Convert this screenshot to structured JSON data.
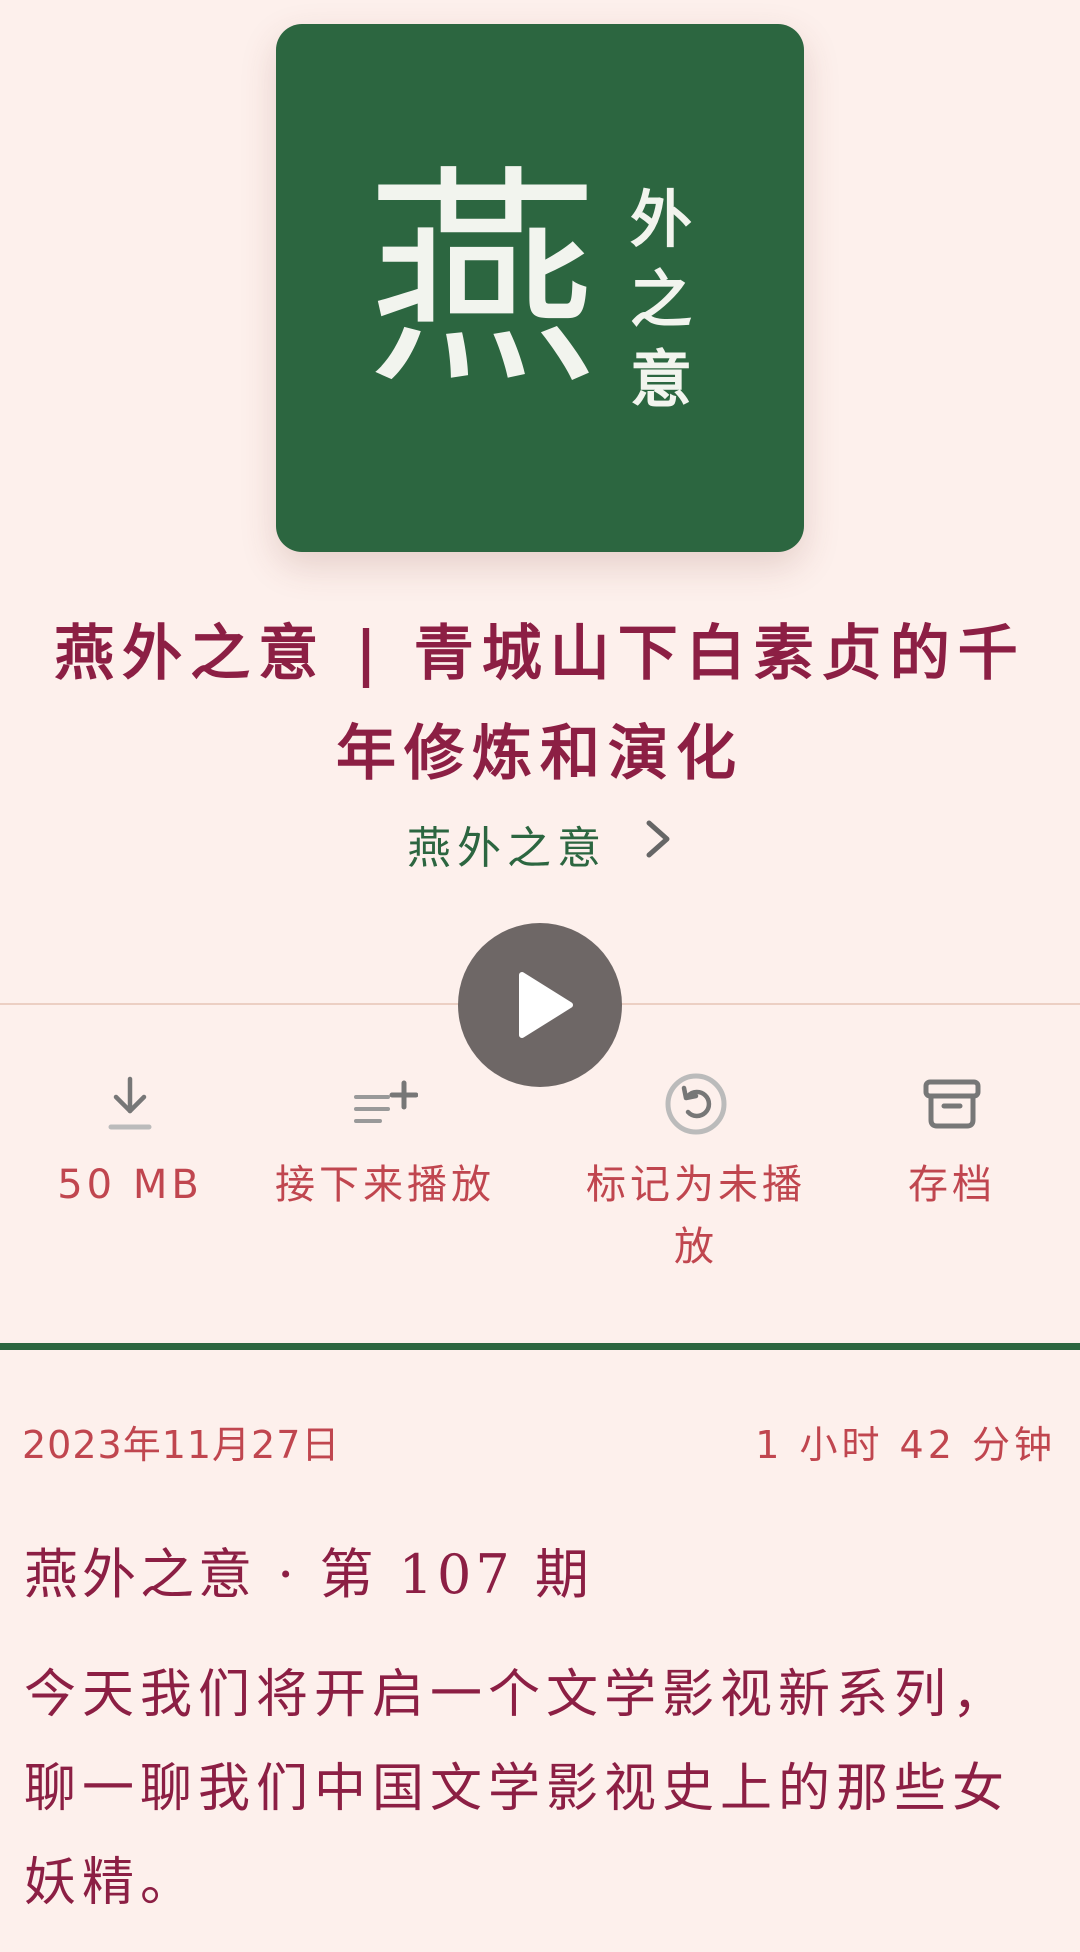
{
  "cover": {
    "big_char": "燕",
    "vertical_chars": [
      "外",
      "之",
      "意"
    ]
  },
  "episode": {
    "title": "燕外之意 | 青城山下白素贞的千年修炼和演化",
    "podcast_name": "燕外之意",
    "date": "2023年11月27日",
    "duration": "1 小时 42 分钟",
    "label": "燕外之意 · 第 107 期",
    "description": "今天我们将开启一个文学影视新系列，聊一聊我们中国文学影视史上的那些女妖精。"
  },
  "actions": {
    "download": {
      "label": "50 MB",
      "icon": "download-icon"
    },
    "play_next": {
      "label": "接下来播放",
      "icon": "queue-add-icon"
    },
    "mark_unplayed": {
      "label": "标记为未播放",
      "icon": "mark-unplayed-icon"
    },
    "archive": {
      "label": "存档",
      "icon": "archive-icon"
    }
  },
  "colors": {
    "background": "#fdf0ec",
    "accent": "#8c1f44",
    "green": "#2c6640",
    "action_text": "#c0464f"
  }
}
